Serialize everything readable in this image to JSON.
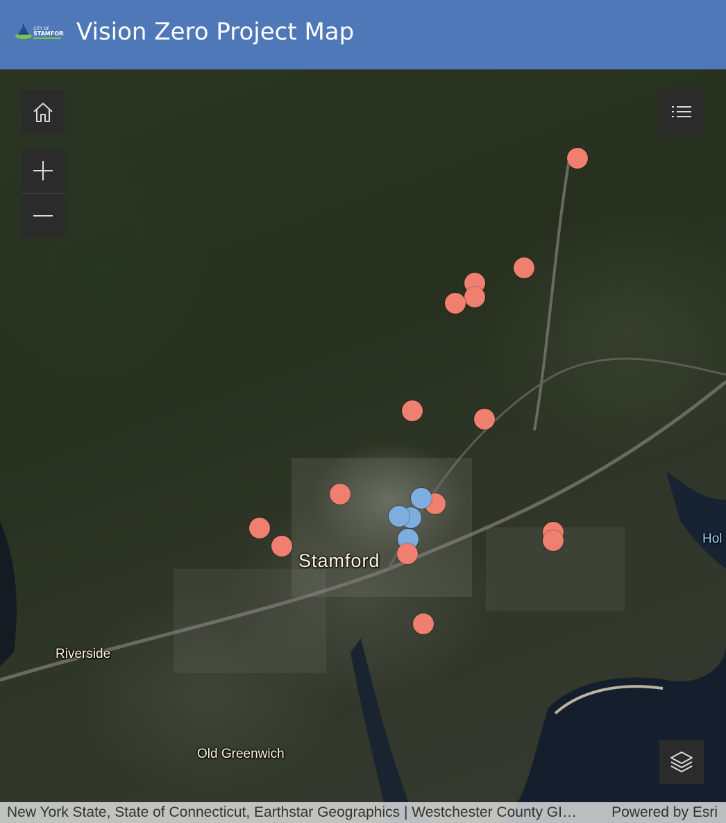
{
  "header": {
    "title": "Vision Zero Project Map",
    "logo_text_top": "CITY OF",
    "logo_text_main": "STAMFORD"
  },
  "map": {
    "basemap": "satellite imagery",
    "labels": {
      "city": "Stamford",
      "riverside": "Riverside",
      "old_greenwich": "Old Greenwich",
      "cut_off": "Hol"
    },
    "point_colors": {
      "red": "#ef8070",
      "blue": "#7eaee0"
    }
  },
  "controls": {
    "home": "home-icon",
    "zoom_in": "plus-icon",
    "zoom_out": "minus-icon",
    "legend": "list-icon",
    "layers": "layers-icon"
  },
  "attribution": {
    "credits": "New York State, State of Connecticut, Earthstar Geographics | Westchester County GIS, Esri",
    "powered": "Powered by Esri"
  }
}
